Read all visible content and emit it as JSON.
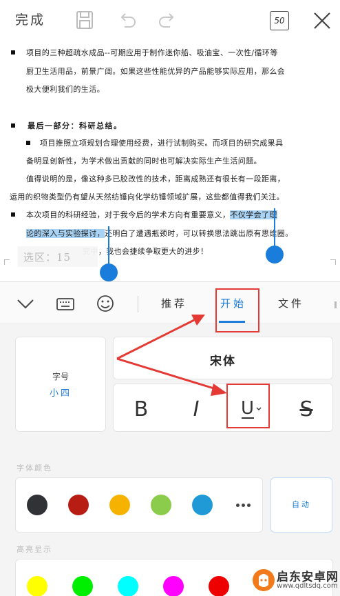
{
  "topbar": {
    "done_label": "完成",
    "word_count": "50",
    "icons": [
      "save-icon",
      "undo-icon",
      "redo-icon",
      "close-icon"
    ]
  },
  "document": {
    "lines": [
      "项目的三种超疏水成品--可期应用于制作迷你船、吸油宝、一次性/循环等",
      "厨卫生活用品，前景广阔。如果这些性能优异的产品能够实际应用，那么会",
      "极大便利我们的生活。",
      "最后一部分：科研总结。",
      "项目推照立项规划合理使用经费，进行试制购买。而项目的研究成果具",
      "备明显创新性，为学术做出贡献的同时也可解决实际生产生活问题。",
      "值得说明的是，像这种多已胶改性的技术，距离成熟还有很长有一段距离，",
      "运用的织物类型仍有望从天然纺锤向化学纺锤领域扩展，这些都值得我们关注。",
      "本次项目的科研经验，对于我今后的学术方向有重要意义，",
      "不仅学会了理",
      "论的深入与实验探讨，",
      "还明白了遭遇瓶颈时，可以转换思法跳出原有思维圈。",
      "究中，我也会捷续争取更大的进步！"
    ],
    "selection_badge": "选区：15"
  },
  "tabs": {
    "icons": [
      "chevron-down-icon",
      "keyboard-icon",
      "emoji-icon"
    ],
    "items": [
      "推荐",
      "开始",
      "文件"
    ],
    "active": "开始"
  },
  "font_panel": {
    "size_label": "字号",
    "size_value": "小四",
    "font_name": "宋体",
    "styles": [
      "B",
      "I",
      "U",
      "S"
    ],
    "font_color_label": "字体颜色",
    "font_colors": [
      "#303236",
      "#b81d14",
      "#f5b300",
      "#8bcc4d",
      "#1f9ad6"
    ],
    "auto_label": "自动",
    "highlight_label": "高亮显示",
    "highlight_colors": [
      "#ffff00",
      "#00ee00",
      "#00ffff",
      "#ff00ff",
      "#ee0000"
    ]
  },
  "annotation_color": "#e53935",
  "accent_color": "#1a7ddc",
  "watermark": {
    "text": "启东安卓网",
    "url": "www.qdltsdq.com"
  }
}
